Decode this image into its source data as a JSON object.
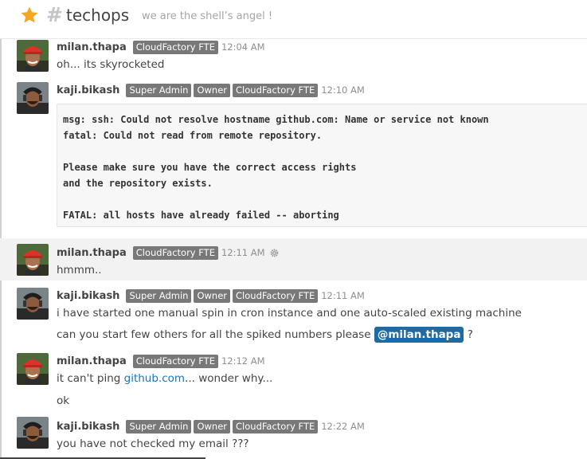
{
  "channel": {
    "name": "techops",
    "topic": "we are the shell’s angel !"
  },
  "messages": [
    {
      "user": "milan.thapa",
      "roles": [
        "CloudFactory FTE"
      ],
      "time": "12:04 AM",
      "text": "oh... its skyrocketed"
    },
    {
      "user": "kaji.bikash",
      "roles": [
        "Super Admin",
        "Owner",
        "CloudFactory FTE"
      ],
      "time": "12:10 AM",
      "code_lines": [
        "msg: ssh: Could not resolve hostname github.com: Name or service not known",
        "fatal: Could not read from remote repository.",
        "",
        "Please make sure you have the correct access rights",
        "and the repository exists.",
        "",
        "FATAL: all hosts have already failed -- aborting"
      ]
    },
    {
      "user": "milan.thapa",
      "roles": [
        "CloudFactory FTE"
      ],
      "time": "12:11 AM",
      "text": "hmmm.."
    },
    {
      "user": "kaji.bikash",
      "roles": [
        "Super Admin",
        "Owner",
        "CloudFactory FTE"
      ],
      "time": "12:11 AM",
      "text": "i have started one manual spin in cron instance and one auto-scaled existing machine",
      "text2": "can you start few others for all the spiked numbers please",
      "mention": "@milan.thapa",
      "suffix": "?"
    },
    {
      "user": "milan.thapa",
      "roles": [
        "CloudFactory FTE"
      ],
      "time": "12:12 AM",
      "text_pre": "it can't ping ",
      "link": "github.com",
      "text_post": "... wonder why...",
      "text2": "ok"
    },
    {
      "user": "kaji.bikash",
      "roles": [
        "Super Admin",
        "Owner",
        "CloudFactory FTE"
      ],
      "time": "12:22 AM",
      "text": "you have not checked my email ???"
    }
  ],
  "icons": {
    "favorite": "star-icon",
    "channel": "hash-icon",
    "settings": "gear-icon"
  },
  "colors": {
    "star": "#f5a623",
    "role_badge": "#787878",
    "mention": "#1d6aa5",
    "link": "#1d74b8",
    "highlight_row": "#f2f2f2"
  }
}
